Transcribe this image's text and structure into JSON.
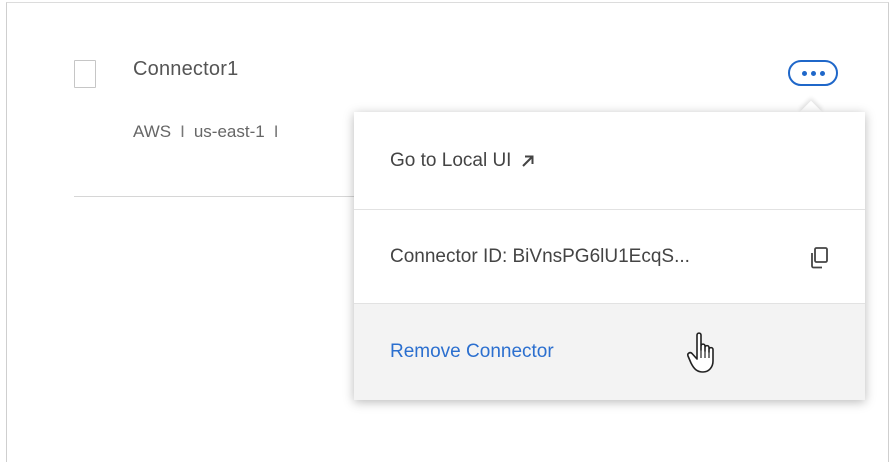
{
  "connector": {
    "name": "Connector1",
    "provider": "AWS",
    "region": "us-east-1",
    "separator": "I"
  },
  "more_button": {
    "icon": "more-horizontal-icon"
  },
  "menu": {
    "local_ui_label": "Go to Local UI",
    "local_ui_icon": "external-link-arrow-icon",
    "connector_id_label": "Connector ID: BiVnsPG6lU1EcqS...",
    "copy_icon": "copy-icon",
    "remove_label": "Remove Connector"
  },
  "colors": {
    "accent": "#1f67c9",
    "link": "#2b6fcf",
    "text": "#444444",
    "hover_bg": "#f3f3f3"
  }
}
